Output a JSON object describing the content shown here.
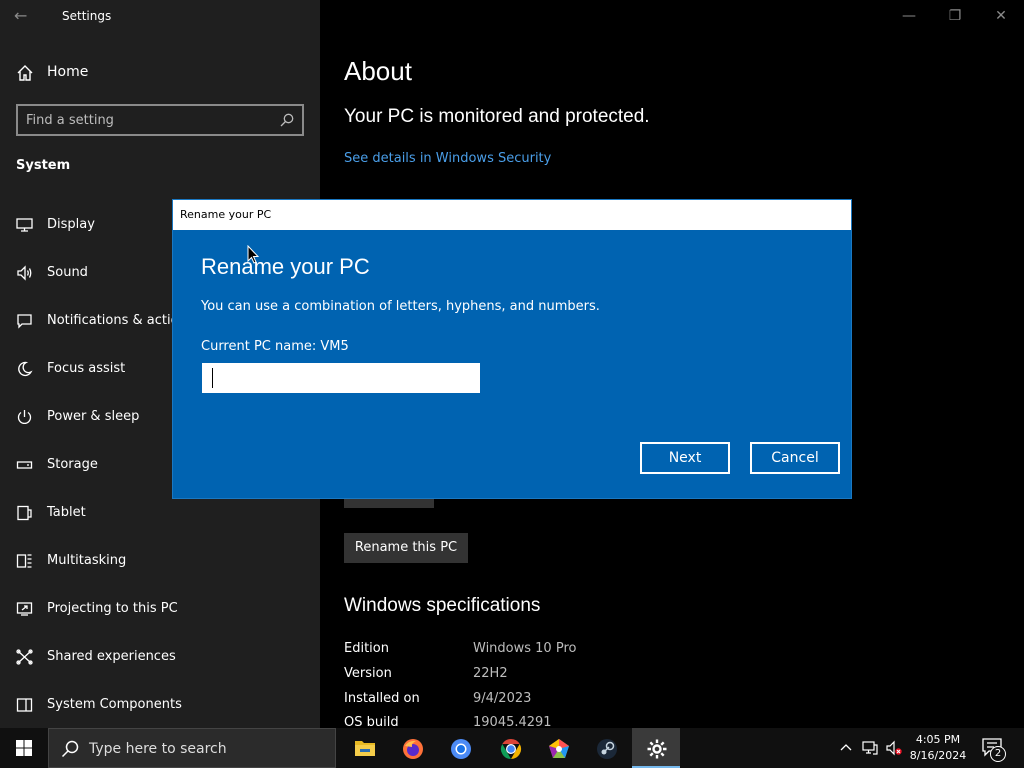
{
  "window": {
    "title": "Settings"
  },
  "sidebar": {
    "home_label": "Home",
    "search_placeholder": "Find a setting",
    "section_title": "System",
    "items": [
      {
        "label": "Display",
        "icon": "display-icon"
      },
      {
        "label": "Sound",
        "icon": "sound-icon"
      },
      {
        "label": "Notifications & actions",
        "icon": "notifications-icon"
      },
      {
        "label": "Focus assist",
        "icon": "focus-assist-icon"
      },
      {
        "label": "Power & sleep",
        "icon": "power-icon"
      },
      {
        "label": "Storage",
        "icon": "storage-icon"
      },
      {
        "label": "Tablet",
        "icon": "tablet-icon"
      },
      {
        "label": "Multitasking",
        "icon": "multitasking-icon"
      },
      {
        "label": "Projecting to this PC",
        "icon": "projecting-icon"
      },
      {
        "label": "Shared experiences",
        "icon": "shared-experiences-icon"
      },
      {
        "label": "System Components",
        "icon": "system-components-icon"
      }
    ]
  },
  "main": {
    "title": "About",
    "protected_text": "Your PC is monitored and protected.",
    "security_link": "See details in Windows Security",
    "rename_button": "Rename this PC",
    "spec_title": "Windows specifications",
    "specs": [
      {
        "key": "Edition",
        "value": "Windows 10 Pro"
      },
      {
        "key": "Version",
        "value": "22H2"
      },
      {
        "key": "Installed on",
        "value": "9/4/2023"
      },
      {
        "key": "OS build",
        "value": "19045.4291"
      }
    ]
  },
  "dialog": {
    "window_title": "Rename your PC",
    "heading": "Rename your PC",
    "description": "You can use a combination of letters, hyphens, and numbers.",
    "current_name": "Current PC name: VM5",
    "input_value": "",
    "next_label": "Next",
    "cancel_label": "Cancel"
  },
  "taskbar": {
    "search_placeholder": "Type here to search",
    "apps": [
      "file-explorer-icon",
      "firefox-icon",
      "chromium-icon",
      "chrome-icon",
      "app-icon",
      "steam-icon",
      "settings-icon"
    ],
    "time": "4:05 PM",
    "date": "8/16/2024",
    "notification_count": "2"
  },
  "colors": {
    "dialog_bg": "#0063b1",
    "link": "#4a9ee8",
    "sidebar_bg": "#1f1f1f",
    "accent": "#76b9ed"
  }
}
